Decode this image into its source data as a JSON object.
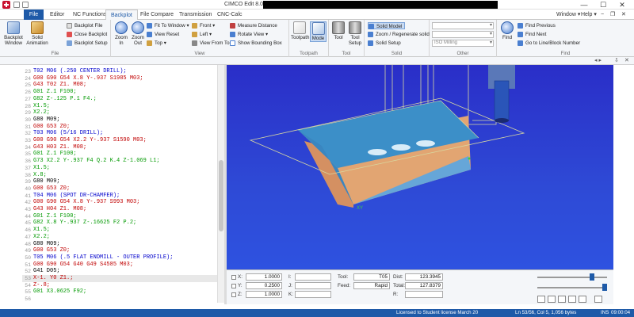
{
  "window": {
    "title": "CIMCO Edit 8.07.15 -",
    "min": "—",
    "max": "☐",
    "close": "✕"
  },
  "tabs": [
    "File",
    "Editor",
    "NC Functions",
    "Backplot",
    "File Compare",
    "Transmission",
    "CNC-Calc"
  ],
  "right_menu": {
    "window": "Window ▾",
    "help": "Help ▾",
    "min": "−",
    "restore": "❐",
    "close": "✕"
  },
  "ribbon": {
    "file": {
      "label": "File",
      "backplot_window": "Backplot Window",
      "solid_animation": "Solid Animation",
      "backplot_file": "Backplot File",
      "close_backplot": "Close Backplot",
      "backplot_setup": "Backplot Setup"
    },
    "view": {
      "label": "View",
      "zoom_in": "Zoom In",
      "zoom_out": "Zoom Out",
      "fit_to_window": "Fit To Window",
      "view_reset": "View Reset",
      "top": "Top",
      "front": "Front",
      "left": "Left",
      "view_from_tool": "View From Tool",
      "measure_distance": "Measure Distance",
      "rotate_view": "Rotate View",
      "show_bounding_box": "Show Bounding Box"
    },
    "toolpath": {
      "label": "Toolpath",
      "toolpath": "Toolpath",
      "mode": "Mode"
    },
    "tool": {
      "label": "Tool",
      "tool": "Tool",
      "tool_setup": "Tool Setup"
    },
    "solid": {
      "label": "Solid",
      "solid_model": "Solid Model",
      "zoom_regenerate": "Zoom / Regenerate solid",
      "solid_setup": "Solid Setup"
    },
    "other": {
      "label": "Other",
      "iso_milling": "ISO Milling"
    },
    "find": {
      "label": "Find",
      "find": "Find",
      "find_previous": "Find Previous",
      "find_next": "Find Next",
      "go_to_line": "Go to Line/Block Number"
    }
  },
  "editor_lines": [
    {
      "n": "23",
      "t": "T02 M06 (.250 CENTER DRILL);",
      "c": "#0000cc"
    },
    {
      "n": "24",
      "t": "G00 G90 G54 X.8 Y-.937 S1985 M03;",
      "c": "#c00000"
    },
    {
      "n": "25",
      "t": "G43 T02 Z1. M08;",
      "c": "#c00000"
    },
    {
      "n": "26",
      "t": "G01 Z.1 F100;",
      "c": "#009900"
    },
    {
      "n": "27",
      "t": "G82 Z-.125 P.1 F4.;",
      "c": "#009900"
    },
    {
      "n": "28",
      "t": "X1.5;",
      "c": "#009900"
    },
    {
      "n": "29",
      "t": "X2.2;",
      "c": "#009900"
    },
    {
      "n": "30",
      "t": "G80 M09;",
      "c": "#000000"
    },
    {
      "n": "31",
      "t": "G00 G53 Z0;",
      "c": "#c00000"
    },
    {
      "n": "32",
      "t": "T03 M06 (5/16 DRILL);",
      "c": "#0000cc"
    },
    {
      "n": "33",
      "t": "G00 G90 G54 X2.2 Y-.937 S1590 M03;",
      "c": "#c00000"
    },
    {
      "n": "34",
      "t": "G43 H03 Z1. M08;",
      "c": "#c00000"
    },
    {
      "n": "35",
      "t": "G01 Z.1 F100;",
      "c": "#009900"
    },
    {
      "n": "36",
      "t": "G73 X2.2 Y-.937 F4 Q.2 K.4 Z-1.069 L1;",
      "c": "#009900"
    },
    {
      "n": "37",
      "t": "X1.5;",
      "c": "#009900"
    },
    {
      "n": "38",
      "t": "X.8;",
      "c": "#009900"
    },
    {
      "n": "39",
      "t": "G80 M09;",
      "c": "#000000"
    },
    {
      "n": "40",
      "t": "G00 G53 Z0;",
      "c": "#c00000"
    },
    {
      "n": "41",
      "t": "T04 M06 (SPOT DR-CHAMFER);",
      "c": "#0000cc"
    },
    {
      "n": "42",
      "t": "G00 G90 G54 X.8 Y-.937 S993 M03;",
      "c": "#c00000"
    },
    {
      "n": "43",
      "t": "G43 H04 Z1. M08;",
      "c": "#c00000"
    },
    {
      "n": "44",
      "t": "G01 Z.1 F100;",
      "c": "#009900"
    },
    {
      "n": "45",
      "t": "G82 X.8 Y-.937 Z-.16625 F2 P.2;",
      "c": "#009900"
    },
    {
      "n": "46",
      "t": "X1.5;",
      "c": "#009900"
    },
    {
      "n": "47",
      "t": "X2.2;",
      "c": "#009900"
    },
    {
      "n": "48",
      "t": "G80 M09;",
      "c": "#000000"
    },
    {
      "n": "49",
      "t": "G00 G53 Z0;",
      "c": "#c00000"
    },
    {
      "n": "50",
      "t": "T05 M06 (.5 FLAT ENDMILL - OUTER PROFILE);",
      "c": "#0000cc"
    },
    {
      "n": "51",
      "t": "G00 G90 G54 G40 G49 S4585 M03;",
      "c": "#c00000"
    },
    {
      "n": "52",
      "t": "G41 D05;",
      "c": "#000000"
    },
    {
      "n": "53",
      "t": "X-1. Y0 Z1.;",
      "c": "#c00000"
    },
    {
      "n": "54",
      "t": "Z-.8;",
      "c": "#c00000"
    },
    {
      "n": "55",
      "t": "G01 X3.0625 F92;",
      "c": "#009900"
    },
    {
      "n": "56",
      "t": "",
      "c": "#000000"
    }
  ],
  "current_line": "53",
  "info": {
    "x_label": "X:",
    "x_val": "1.0000",
    "y_label": "Y:",
    "y_val": "0.2500",
    "z_label": "Z:",
    "z_val": "1.0000",
    "i_label": "I:",
    "j_label": "J:",
    "k_label": "K:",
    "tool_label": "Tool:",
    "tool_val": "T05",
    "feed_label": "Feed:",
    "feed_val": "Rapid",
    "dist_label": "Dist:",
    "dist_val": "123.3945",
    "total_label": "Total:",
    "total_val": "127.8379",
    "r_label": "R:"
  },
  "status": {
    "license": "Licensed to Student license March 20",
    "position": "Ln 53/56, Col 5, 1,056 bytes",
    "ins": "INS",
    "time": "09:00:04"
  },
  "colors": {
    "accent": "#1e5aa8",
    "viewport": "#2e40d4"
  }
}
